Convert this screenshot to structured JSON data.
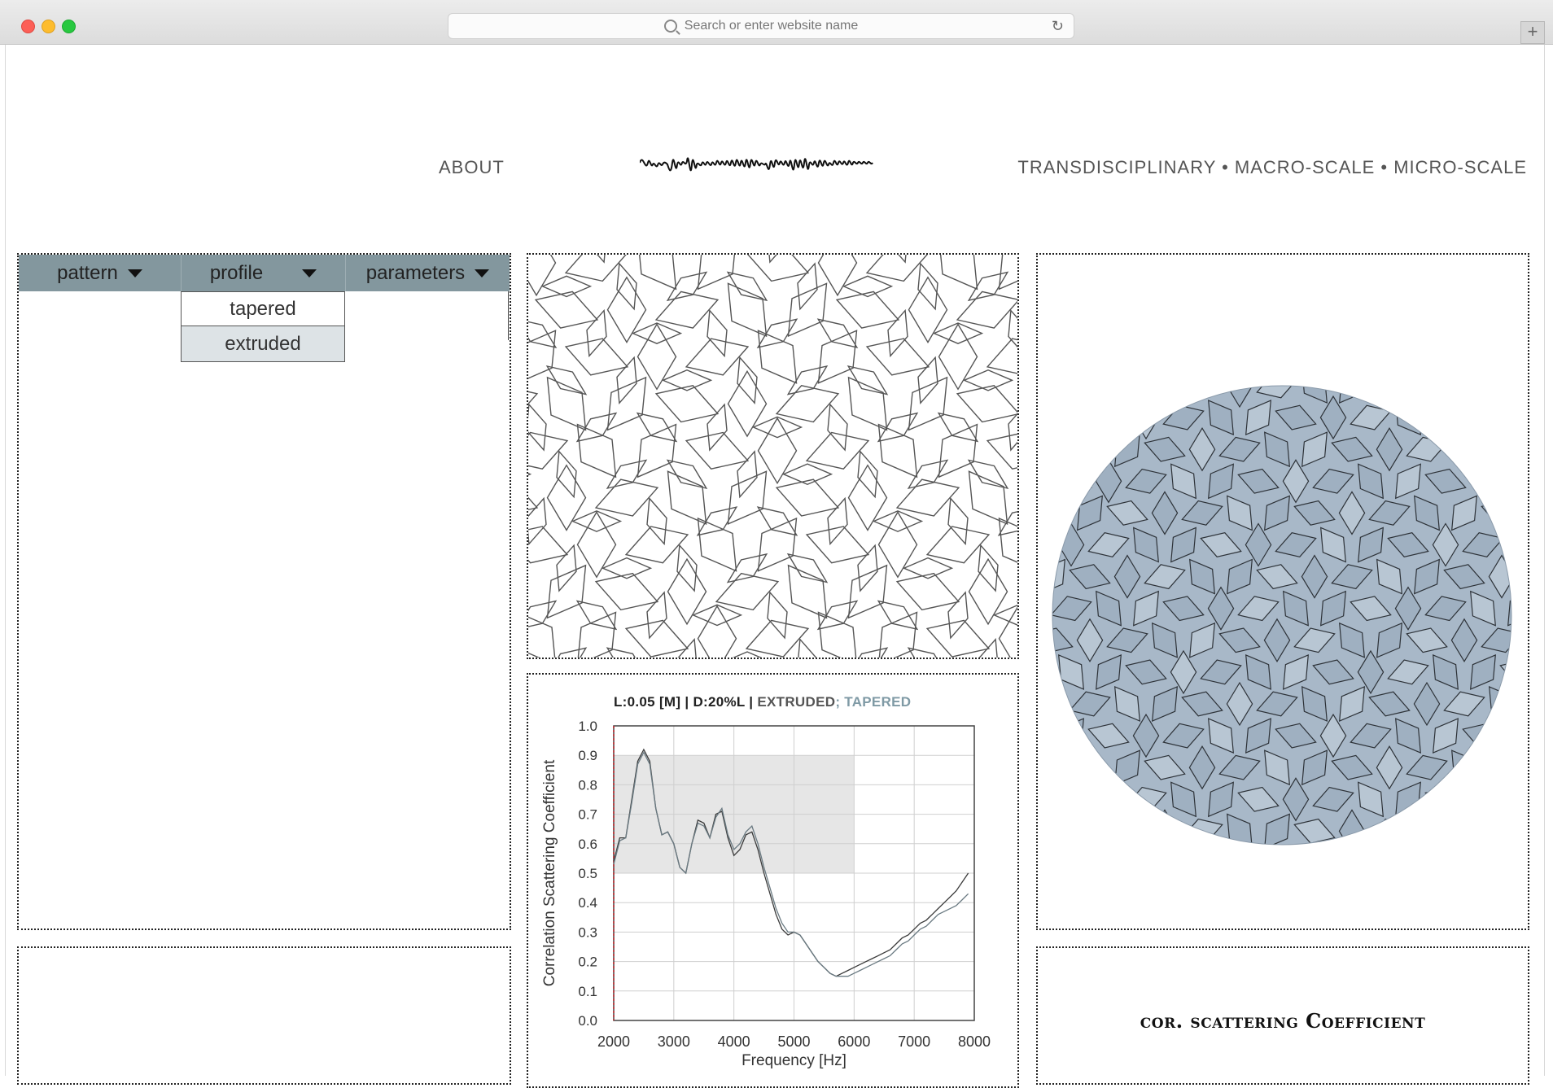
{
  "browser": {
    "url_placeholder": "Search or enter website name",
    "newtab_label": "+"
  },
  "nav": {
    "about": "ABOUT",
    "right": "TRANSDISCIPLINARY • MACRO-SCALE • MICRO-SCALE"
  },
  "controls": {
    "tabs": [
      {
        "label": "pattern"
      },
      {
        "label": "profile"
      },
      {
        "label": "parameters"
      }
    ],
    "profile_options": [
      {
        "label": "tapered",
        "selected": false
      },
      {
        "label": "extruded",
        "selected": true
      }
    ]
  },
  "chart_title": {
    "part1": "L:0.05 [M] | D:20%L | ",
    "part2": "EXTRUDED",
    "part3": "; TAPERED"
  },
  "colors": {
    "tab_bg": "#83979e",
    "render_fill": "#a8b8c8",
    "highlight_band": "#e6e6e6",
    "title_blue": "#7f9aa5"
  },
  "chart_data": {
    "type": "line",
    "title": "L:0.05 [M] | D:20%L | EXTRUDED; TAPERED",
    "xlabel": "Frequency [Hz]",
    "ylabel": "Correlation Scattering Coefficient",
    "xlim": [
      2000,
      8000
    ],
    "ylim": [
      0.0,
      1.0
    ],
    "xticks": [
      "2000",
      "3000",
      "4000",
      "5000",
      "6000",
      "7000",
      "8000"
    ],
    "yticks": [
      "0.0",
      "0.1",
      "0.2",
      "0.3",
      "0.4",
      "0.5",
      "0.6",
      "0.7",
      "0.8",
      "0.9",
      "1.0"
    ],
    "grid": true,
    "highlight_region": {
      "x": [
        2000,
        6000
      ],
      "y": [
        0.5,
        0.9
      ]
    },
    "series": [
      {
        "name": "EXTRUDED",
        "x": [
          2000,
          2100,
          2200,
          2300,
          2400,
          2500,
          2600,
          2700,
          2800,
          2900,
          3000,
          3100,
          3200,
          3300,
          3400,
          3500,
          3600,
          3700,
          3800,
          3900,
          4000,
          4100,
          4200,
          4300,
          4400,
          4500,
          4600,
          4700,
          4800,
          4900,
          5000,
          5100,
          5200,
          5300,
          5400,
          5500,
          5600,
          5700,
          5800,
          5900,
          6000,
          6100,
          6200,
          6300,
          6400,
          6500,
          6600,
          6700,
          6800,
          6900,
          7000,
          7100,
          7200,
          7300,
          7400,
          7500,
          7600,
          7700,
          7800,
          7900
        ],
        "y": [
          0.54,
          0.62,
          0.62,
          0.75,
          0.88,
          0.92,
          0.88,
          0.72,
          0.63,
          0.64,
          0.6,
          0.52,
          0.5,
          0.6,
          0.68,
          0.67,
          0.62,
          0.7,
          0.71,
          0.62,
          0.56,
          0.58,
          0.63,
          0.64,
          0.58,
          0.5,
          0.43,
          0.36,
          0.31,
          0.29,
          0.3,
          0.29,
          0.26,
          0.23,
          0.2,
          0.18,
          0.16,
          0.15,
          0.16,
          0.17,
          0.18,
          0.19,
          0.2,
          0.21,
          0.22,
          0.23,
          0.24,
          0.26,
          0.28,
          0.29,
          0.31,
          0.33,
          0.34,
          0.36,
          0.38,
          0.4,
          0.42,
          0.44,
          0.47,
          0.5
        ]
      },
      {
        "name": "TAPERED",
        "x": [
          2000,
          2100,
          2200,
          2300,
          2400,
          2500,
          2600,
          2700,
          2800,
          2900,
          3000,
          3100,
          3200,
          3300,
          3400,
          3500,
          3600,
          3700,
          3800,
          3900,
          4000,
          4100,
          4200,
          4300,
          4400,
          4500,
          4600,
          4700,
          4800,
          4900,
          5000,
          5100,
          5200,
          5300,
          5400,
          5500,
          5600,
          5700,
          5800,
          5900,
          6000,
          6100,
          6200,
          6300,
          6400,
          6500,
          6600,
          6700,
          6800,
          6900,
          7000,
          7100,
          7200,
          7300,
          7400,
          7500,
          7600,
          7700,
          7800,
          7900
        ],
        "y": [
          0.53,
          0.61,
          0.62,
          0.74,
          0.87,
          0.91,
          0.87,
          0.72,
          0.63,
          0.64,
          0.6,
          0.52,
          0.5,
          0.6,
          0.67,
          0.66,
          0.62,
          0.69,
          0.72,
          0.63,
          0.58,
          0.6,
          0.64,
          0.66,
          0.6,
          0.52,
          0.45,
          0.38,
          0.33,
          0.3,
          0.3,
          0.29,
          0.26,
          0.23,
          0.2,
          0.18,
          0.16,
          0.15,
          0.15,
          0.15,
          0.16,
          0.17,
          0.18,
          0.19,
          0.2,
          0.21,
          0.22,
          0.24,
          0.26,
          0.27,
          0.29,
          0.31,
          0.32,
          0.34,
          0.36,
          0.37,
          0.38,
          0.39,
          0.41,
          0.43
        ]
      }
    ]
  },
  "label_panel": {
    "text": "cor. scattering Coefficient"
  }
}
